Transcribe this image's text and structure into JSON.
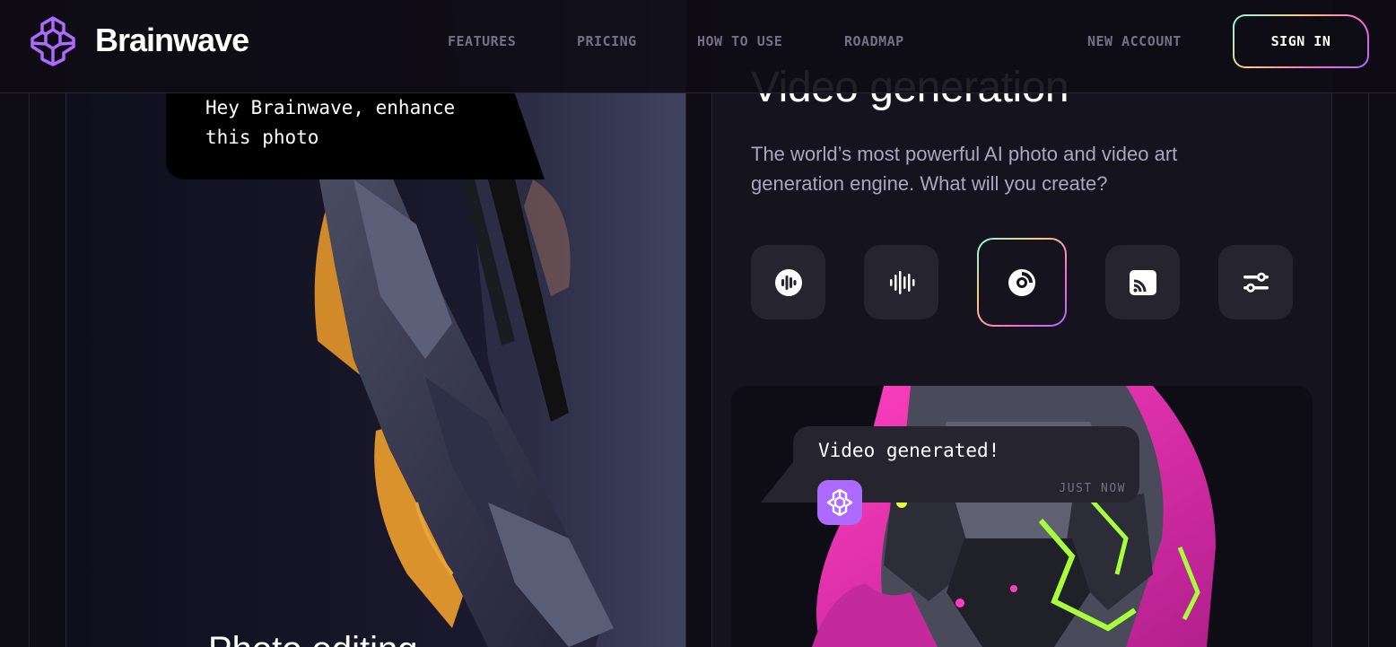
{
  "brand": {
    "name": "Brainwave",
    "accent": "#ac6aff"
  },
  "nav": {
    "items": [
      {
        "label": "FEATURES"
      },
      {
        "label": "PRICING"
      },
      {
        "label": "HOW TO USE"
      },
      {
        "label": "ROADMAP"
      }
    ],
    "new_account": "NEW ACCOUNT",
    "sign_in": "SIGN IN"
  },
  "photo_card": {
    "prompt": "Hey Brainwave, enhance this photo",
    "title": "Photo editing"
  },
  "video_card": {
    "title": "Video generation",
    "description": "The world’s most powerful AI photo and video art generation engine. What will you create?",
    "tools": [
      {
        "icon": "podcast-icon"
      },
      {
        "icon": "sound-wave-icon"
      },
      {
        "icon": "disc-icon",
        "active": true
      },
      {
        "icon": "cast-icon"
      },
      {
        "icon": "sliders-icon"
      }
    ],
    "notification": {
      "text": "Video generated!",
      "time": "JUST NOW"
    }
  }
}
